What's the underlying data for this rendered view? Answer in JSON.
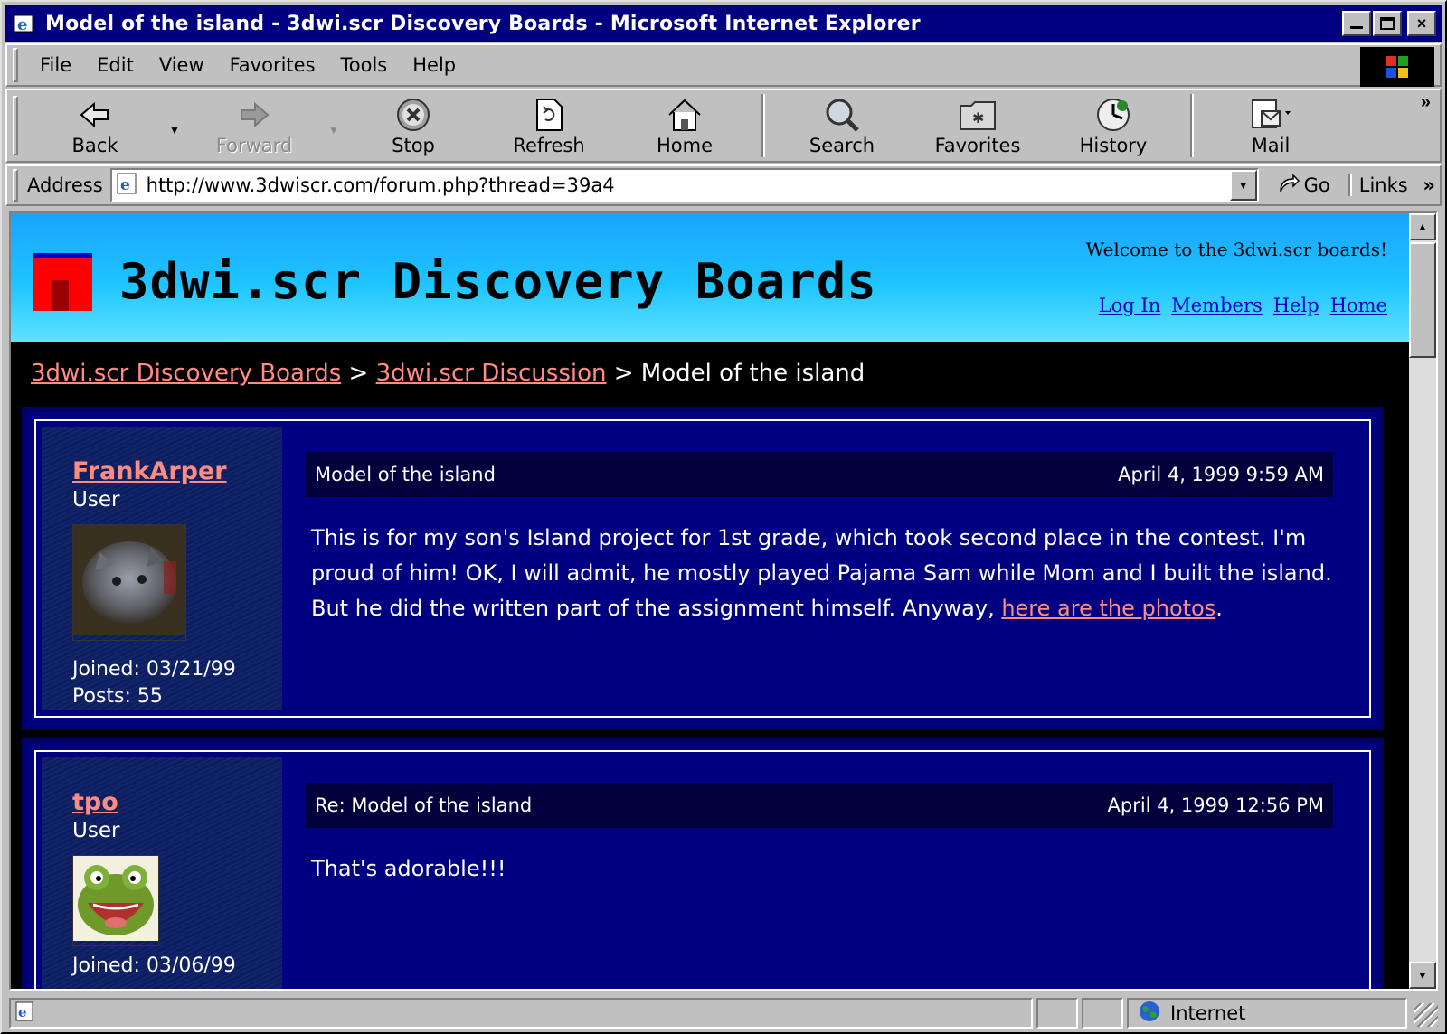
{
  "window": {
    "title": "Model of the island - 3dwi.scr Discovery Boards - Microsoft Internet Explorer",
    "controls": {
      "minimize": "_",
      "maximize": "□",
      "close": "×"
    }
  },
  "menu": [
    {
      "label": "File"
    },
    {
      "label": "Edit"
    },
    {
      "label": "View"
    },
    {
      "label": "Favorites"
    },
    {
      "label": "Tools"
    },
    {
      "label": "Help"
    }
  ],
  "toolbar": {
    "back": "Back",
    "forward": "Forward",
    "stop": "Stop",
    "refresh": "Refresh",
    "home": "Home",
    "search": "Search",
    "favorites": "Favorites",
    "history": "History",
    "mail": "Mail",
    "more": "»"
  },
  "address": {
    "label": "Address",
    "url": "http://www.3dwiscr.com/forum.php?thread=39a4",
    "go": "Go",
    "links": "Links"
  },
  "site": {
    "title": "3dwi.scr Discovery Boards",
    "welcome": "Welcome to the 3dwi.scr boards!",
    "nav": [
      "Log In",
      "Members",
      "Help",
      "Home"
    ]
  },
  "breadcrumb": {
    "root": "3dwi.scr Discovery Boards",
    "forum": "3dwi.scr Discussion",
    "sep": ">",
    "current": "Model of the island"
  },
  "posts": [
    {
      "username": "FrankArper",
      "role": "User",
      "joined": "Joined: 03/21/99",
      "posts": "Posts: 55",
      "subject": "Model of the island",
      "date": "April 4, 1999 9:59 AM",
      "body": "This is for my son's Island project for 1st grade, which took second place in the contest. I'm proud of him! OK, I will admit, he mostly played Pajama Sam while Mom and I built the island. But he did the written part of the assignment himself. Anyway, ",
      "link": "here are the photos",
      "body_end": "."
    },
    {
      "username": "tpo",
      "role": "User",
      "joined": "Joined: 03/06/99",
      "subject": "Re: Model of the island",
      "date": "April 4, 1999 12:56 PM",
      "body": "That's adorable!!!"
    }
  ],
  "status": {
    "zone": "Internet"
  },
  "colors": {
    "titlebar": "#000080",
    "header_gradient_top": "#1aa3ff",
    "post_bg": "#000080",
    "link": "#ff8c80"
  }
}
